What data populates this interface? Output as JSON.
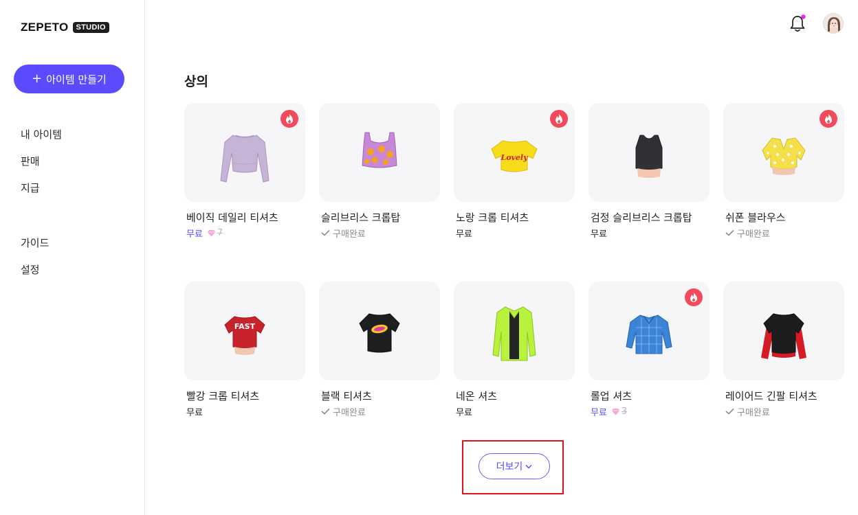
{
  "logo": {
    "word": "ZEPETO",
    "badge": "STUDIO"
  },
  "sidebar": {
    "create_label": "아이템 만들기",
    "items": [
      {
        "label": "내 아이템"
      },
      {
        "label": "판매"
      },
      {
        "label": "지급"
      },
      {
        "label": "가이드"
      },
      {
        "label": "설정"
      }
    ]
  },
  "header": {
    "notification_dot_color": "#e62ce0"
  },
  "section": {
    "title": "상의"
  },
  "items": [
    {
      "name": "베이직 데일리 티셔츠",
      "price_label": "무료",
      "price_style": "purple",
      "gem_count": "7",
      "hot": true,
      "icon": "lavender-longsleeve-crop"
    },
    {
      "name": "슬리브리스 크롭탑",
      "owned_label": "구매완료",
      "hot": false,
      "icon": "purple-lemon-croptop"
    },
    {
      "name": "노랑 크롭 티셔츠",
      "price_label": "무료",
      "price_style": "plain",
      "hot": true,
      "icon": "yellow-lovely-tee",
      "print_text": "Lovely"
    },
    {
      "name": "검정 슬리브리스 크롭탑",
      "price_label": "무료",
      "price_style": "plain",
      "hot": false,
      "icon": "black-tank-crop"
    },
    {
      "name": "쉬폰 블라우스",
      "owned_label": "구매완료",
      "hot": true,
      "icon": "yellow-floral-blouse"
    },
    {
      "name": "빨강 크롭 티셔츠",
      "price_label": "무료",
      "price_style": "plain",
      "hot": false,
      "icon": "red-fast-tee",
      "print_text": "FAST"
    },
    {
      "name": "블랙 티셔츠",
      "owned_label": "구매완료",
      "hot": false,
      "icon": "black-graphic-tee"
    },
    {
      "name": "네온 셔츠",
      "price_label": "무료",
      "price_style": "plain",
      "hot": false,
      "icon": "neon-green-shirt"
    },
    {
      "name": "롤업 셔츠",
      "price_label": "무료",
      "price_style": "purple",
      "gem_count": "3",
      "hot": true,
      "icon": "blue-check-shirt"
    },
    {
      "name": "레이어드 긴팔 티셔츠",
      "owned_label": "구매완료",
      "hot": false,
      "icon": "black-red-layered-tee"
    }
  ],
  "more_button": {
    "label": "더보기"
  },
  "colors": {
    "accent": "#5a4bff",
    "hot_badge": "#f24a5b",
    "highlight_box": "#e0101e"
  }
}
